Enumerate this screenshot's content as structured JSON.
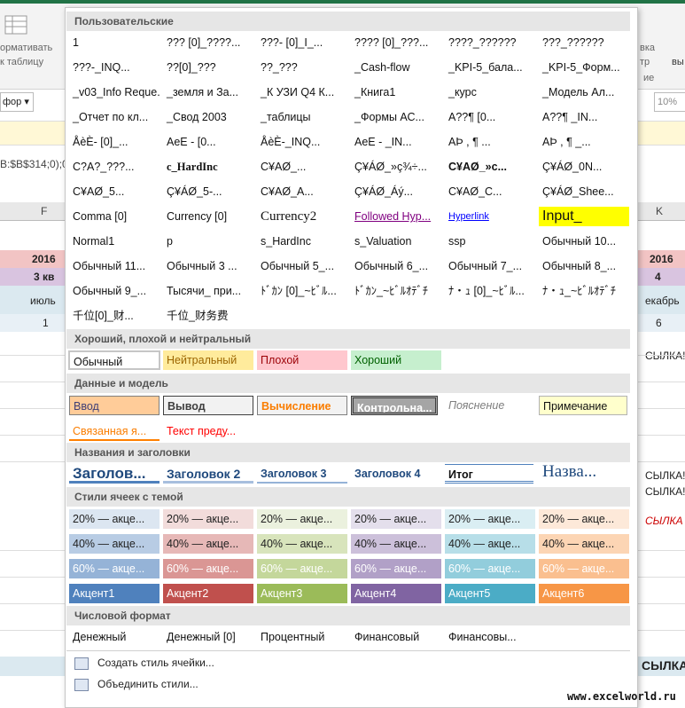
{
  "excel_bg": {
    "ribbon_left": [
      "ормативать",
      "к таблицу"
    ],
    "ribbon_right": [
      "вка",
      "тр",
      "вы"
    ],
    "ribbon_right2": [
      "ие"
    ],
    "font_box": "фор",
    "zoom_box": "10%",
    "formula": "B:$B$314;0);0",
    "col_f": "F",
    "col_k": "K",
    "left_rows": [
      "2016",
      "3 кв",
      "июль",
      "1"
    ],
    "right_rows": [
      "2016",
      "4",
      "екабрь",
      "6"
    ],
    "right_links": [
      "СЫЛКА!",
      "СЫЛКА!",
      "СЫЛКА!",
      "СЫЛКА",
      "СЫЛКА"
    ],
    "watermark": "www.excelworld.ru"
  },
  "panel": {
    "sections": {
      "custom": "Пользовательские",
      "good_bad": "Хороший, плохой и нейтральный",
      "data_model": "Данные и модель",
      "titles": "Названия и заголовки",
      "themed": "Стили ячеек с темой",
      "number": "Числовой формат"
    },
    "custom_rows": [
      [
        "1",
        "??? [0]_????...",
        "???- [0]_I_...",
        "???? [0]_???...",
        "????_??????",
        "???_??????"
      ],
      [
        "???-_INQ...",
        "??[0]_???",
        "??_???",
        "_Cash-flow",
        "_KPI-5_бала...",
        "_KPI-5_Форм..."
      ],
      [
        "_v03_Info Reque...",
        "_земля и За...",
        "_К УЗИ Q4 К...",
        "_Книга1",
        "_курс",
        "_Модель Ал..."
      ],
      [
        "_Отчет по кл...",
        "_Свод 2003",
        "_таблицы",
        "_Формы АС...",
        "A??¶ [0...",
        "A??¶ _IN..."
      ],
      [
        "ÅèÈ- [0]_...",
        "AeE - [0...",
        "ÅèÈ-_INQ...",
        "AeE - _IN...",
        "AÞ , ¶ ...",
        "AÞ , ¶ _..."
      ],
      [
        "C?A?_???...",
        "c_HardInc",
        "C¥AØ_...",
        "Ç¥ÁØ_»ç¾÷...",
        "C¥AØ_»c...",
        "Ç¥ÁØ_0N..."
      ],
      [
        "C¥AØ_5...",
        "Ç¥ÁØ_5-...",
        "C¥AØ_A...",
        "Ç¥ÁØ_Áý...",
        "C¥AØ_C...",
        "Ç¥ÁØ_Shee..."
      ],
      [
        "Comma [0]",
        "Currency [0]",
        "Currency2",
        "Followed Hyp...",
        "Hyperlink",
        "Input_"
      ],
      [
        "Normal1",
        "p",
        "s_HardInc",
        "s_Valuation",
        "ssp",
        "Обычный 10..."
      ],
      [
        "Обычный 11...",
        "Обычный 3 ...",
        "Обычный 5_...",
        "Обычный 6_...",
        "Обычный 7_...",
        "Обычный 8_..."
      ],
      [
        "Обычный 9_...",
        "Тысячи_ при...",
        "ﾄﾞｶﾝ [0]_~ﾋﾞﾙ...",
        "ﾄﾞｶﾝ_~ﾋﾞﾙｵﾃﾞﾁ",
        "ﾅ・ｭ [0]_~ﾋﾞﾙ...",
        "ﾅ・ｭ_~ﾋﾞﾙｵﾃﾞﾁ"
      ],
      [
        "千位[0]_财...",
        "千位_财务费"
      ]
    ],
    "good_bad": [
      "Обычный",
      "Нейтральный",
      "Плохой",
      "Хороший"
    ],
    "data_model_row1": [
      "Ввод",
      "Вывод",
      "Вычисление",
      "Контрольна...",
      "Пояснение",
      "Примечание"
    ],
    "data_model_row2": [
      "Связанная я...",
      "Текст преду..."
    ],
    "titles": [
      "Заголов...",
      "Заголовок 2",
      "Заголовок 3",
      "Заголовок 4",
      "Итог",
      "Назва..."
    ],
    "themed_20": [
      "20% — акце...",
      "20% — акце...",
      "20% — акце...",
      "20% — акце...",
      "20% — акце...",
      "20% — акце..."
    ],
    "themed_40": [
      "40% — акце...",
      "40% — акце...",
      "40% — акце...",
      "40% — акце...",
      "40% — акце...",
      "40% — акце..."
    ],
    "themed_60": [
      "60% — акце...",
      "60% — акце...",
      "60% — акце...",
      "60% — акце...",
      "60% — акце...",
      "60% — акце..."
    ],
    "themed_accent": [
      "Акцент1",
      "Акцент2",
      "Акцент3",
      "Акцент4",
      "Акцент5",
      "Акцент6"
    ],
    "number": [
      "Денежный",
      "Денежный [0]",
      "Процентный",
      "Финансовый",
      "Финансовы..."
    ],
    "menu": {
      "create": "Создать стиль ячейки...",
      "merge": "Объединить стили..."
    },
    "colors": {
      "accent1": "#4f81bd",
      "accent2": "#c0504d",
      "accent3": "#9bbb59",
      "accent4": "#8064a2",
      "accent5": "#4bacc6",
      "accent6": "#f79646"
    }
  }
}
